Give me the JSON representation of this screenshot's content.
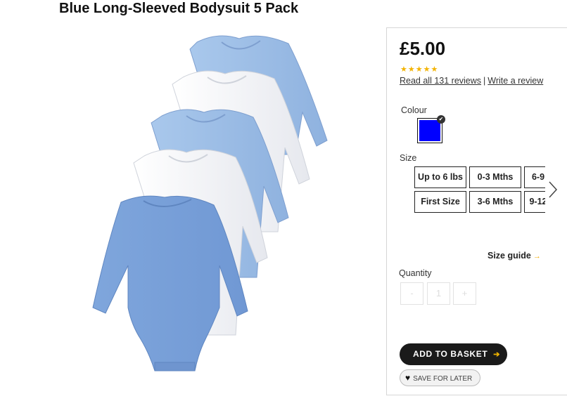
{
  "product": {
    "title": "Blue Long-Sleeved Bodysuit 5 Pack",
    "image_icon": "bodysuit-5-pack-image"
  },
  "pricing": {
    "price": "£5.00",
    "stars": "★★★★★",
    "rating": 5,
    "read_reviews": "Read all 131 reviews",
    "separator": "|",
    "write_review": "Write a review"
  },
  "colour": {
    "label": "Colour",
    "selected_color": "#0000ff",
    "check": "✔"
  },
  "size": {
    "label": "Size",
    "options": [
      "Up to 6 lbs",
      "0-3 Mths",
      "6-9",
      "First Size",
      "3-6 Mths",
      "9-12"
    ],
    "guide": "Size guide",
    "guide_arrow": "→"
  },
  "quantity": {
    "label": "Quantity",
    "minus": "-",
    "value": "1",
    "plus": "+"
  },
  "actions": {
    "add_to_basket": "ADD TO BASKET",
    "add_arrow": "➔",
    "save_for_later": "SAVE FOR LATER",
    "heart": "♥"
  },
  "colors": {
    "accent": "#f0b400",
    "button_dark": "#1a1a1a",
    "bodysuit_blue": "#9dbee6",
    "bodysuit_white": "#f4f5f8"
  }
}
